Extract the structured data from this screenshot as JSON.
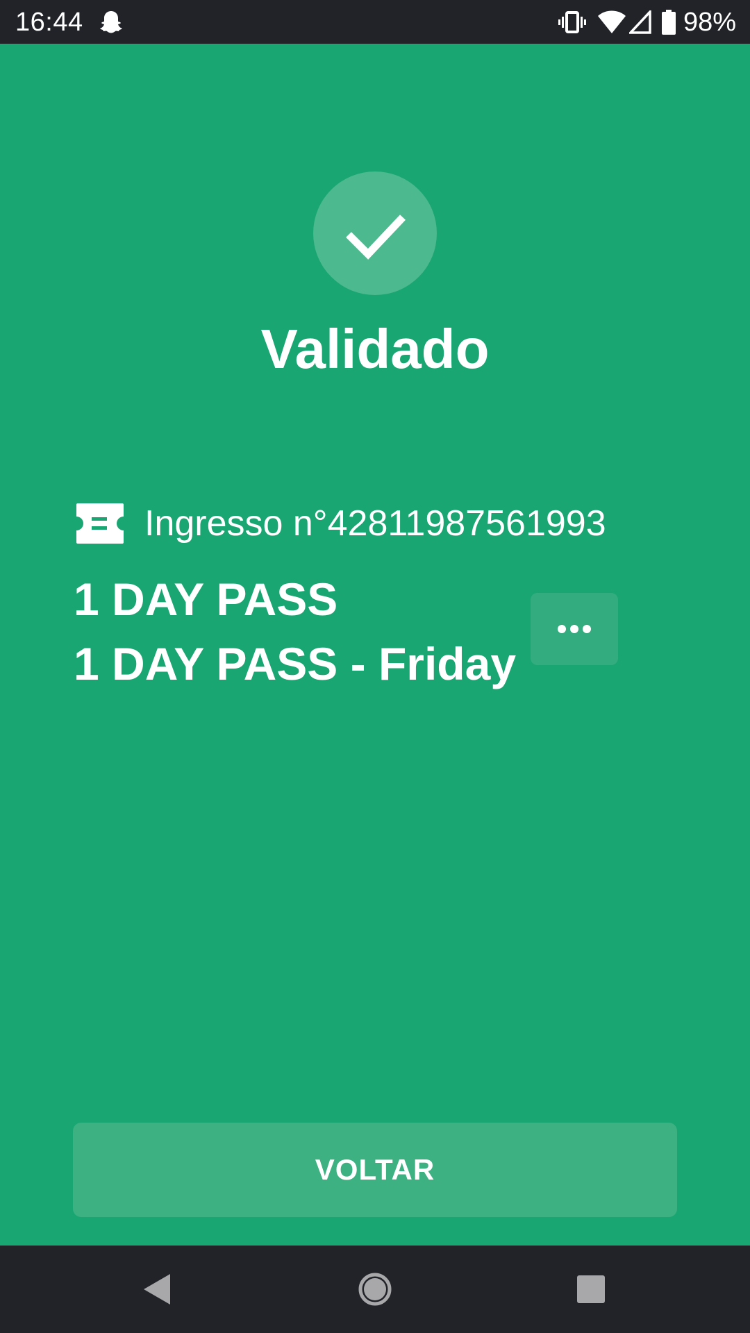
{
  "status_bar": {
    "time": "16:44",
    "battery_percent": "98%",
    "icons": [
      "snapchat-icon",
      "vibrate-icon",
      "wifi-icon",
      "cell-signal-icon",
      "battery-icon"
    ]
  },
  "result": {
    "icon": "checkmark-icon",
    "title": "Validado"
  },
  "ticket": {
    "icon": "ticket-icon",
    "number_label": "Ingresso n°42811987561993",
    "pass_name": "1 DAY PASS",
    "pass_detail": "1 DAY PASS - Friday",
    "more_icon": "more-horizontal-icon"
  },
  "actions": {
    "back_label": "VOLTAR"
  },
  "navigation": {
    "buttons": [
      "back-triangle-icon",
      "home-circle-icon",
      "recents-square-icon"
    ]
  },
  "colors": {
    "background": "#19a672",
    "system_bars": "#212329",
    "check_circle": "#4cb98e",
    "button": "#3db182",
    "text": "#ffffff"
  }
}
